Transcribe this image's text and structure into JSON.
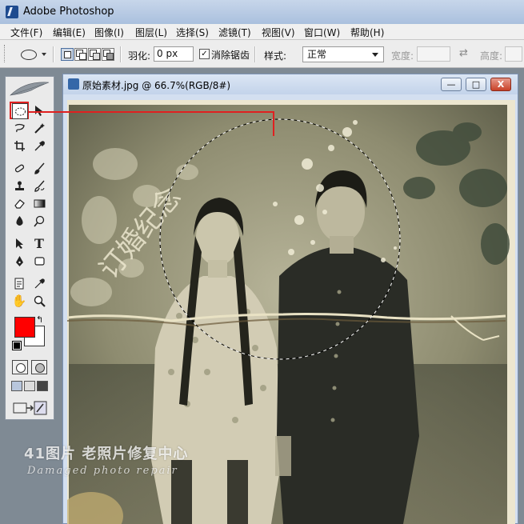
{
  "app": {
    "title": "Adobe Photoshop"
  },
  "menu": [
    "文件(F)",
    "编辑(E)",
    "图像(I)",
    "图层(L)",
    "选择(S)",
    "滤镜(T)",
    "视图(V)",
    "窗口(W)",
    "帮助(H)"
  ],
  "options": {
    "feather_label": "羽化:",
    "feather_value": "0 px",
    "antialias_label": "消除锯齿",
    "antialias_checked": true,
    "style_label": "样式:",
    "style_value": "正常",
    "width_label": "宽度:",
    "height_label": "高度:"
  },
  "toolbox": {
    "foreground_color": "#ff0000",
    "background_color": "#ffffff",
    "highlight_color": "#e02020",
    "tools": [
      "elliptical-marquee",
      "move",
      "lasso",
      "magic-wand",
      "crop",
      "eyedropper",
      "healing-brush",
      "brush",
      "clone-stamp",
      "history-brush",
      "eraser",
      "gradient",
      "blur",
      "dodge",
      "path-selection",
      "type",
      "pen",
      "rectangle",
      "notes",
      "eyedropper-2",
      "hand",
      "zoom"
    ]
  },
  "document": {
    "title": "原始素材.jpg @ 66.7%(RGB/8#)",
    "minimize": "—",
    "maximize": "□",
    "close": "X"
  },
  "photo": {
    "handwriting": "订婚纪念"
  },
  "watermark": {
    "line1": "41图片 老照片修复中心",
    "line2": "Damaged photo repair"
  }
}
